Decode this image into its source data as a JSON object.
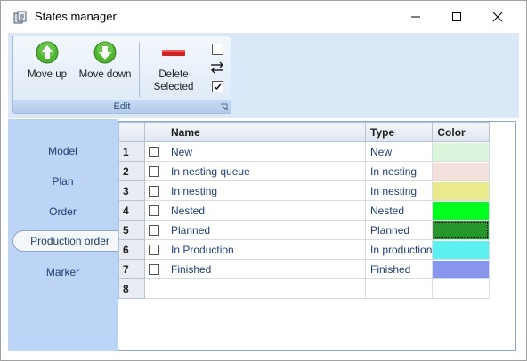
{
  "window": {
    "title": "States manager"
  },
  "ribbon": {
    "group_label": "Edit",
    "buttons": {
      "move_up": "Move up",
      "move_down": "Move down",
      "delete_line1": "Delete",
      "delete_line2": "Selected"
    },
    "icons": [
      "move-up-icon",
      "move-down-icon",
      "delete-icon",
      "select-none-icon",
      "invert-selection-icon",
      "select-all-icon"
    ],
    "colors": {
      "green": "#4fb531",
      "delete_red": "#d81f1f"
    }
  },
  "nav": {
    "items": [
      {
        "label": "Model",
        "active": false
      },
      {
        "label": "Plan",
        "active": false
      },
      {
        "label": "Order",
        "active": false
      },
      {
        "label": "Production order",
        "active": true
      },
      {
        "label": "Marker",
        "active": false
      }
    ]
  },
  "grid": {
    "columns": [
      "Name",
      "Type",
      "Color"
    ],
    "rows": [
      {
        "num": "1",
        "name": "New",
        "type": "New",
        "color": "#d9f5dc"
      },
      {
        "num": "2",
        "name": "In nesting queue",
        "type": "In nesting",
        "color": "#f5e1dc"
      },
      {
        "num": "3",
        "name": "In nesting",
        "type": "In nesting",
        "color": "#eaea8c"
      },
      {
        "num": "4",
        "name": "Nested",
        "type": "Nested",
        "color": "#00ff1f"
      },
      {
        "num": "5",
        "name": "Planned",
        "type": "Planned",
        "color": "#27962d"
      },
      {
        "num": "6",
        "name": "In Production",
        "type": "In production",
        "color": "#5cf0f0"
      },
      {
        "num": "7",
        "name": "Finished",
        "type": "Finished",
        "color": "#8796ec"
      },
      {
        "num": "8",
        "name": "",
        "type": "",
        "color": ""
      }
    ]
  }
}
